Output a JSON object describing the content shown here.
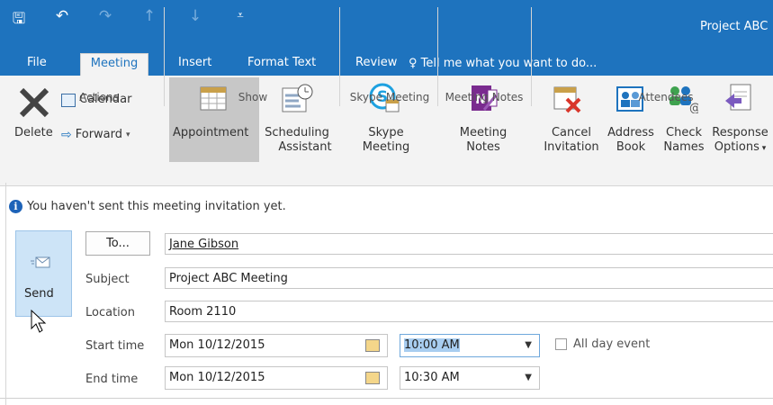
{
  "window": {
    "title": "Project ABC"
  },
  "tabs": [
    "File",
    "Meeting",
    "Insert",
    "Format Text",
    "Review"
  ],
  "tell_me": "Tell me what you want to do...",
  "ribbon": {
    "actions": {
      "delete": "Delete",
      "calendar": "Calendar",
      "forward": "Forward",
      "group": "Actions"
    },
    "show": {
      "appointment": "Appointment",
      "scheduling_1": "Scheduling",
      "scheduling_2": "Assistant",
      "group": "Show"
    },
    "skype": {
      "line1": "Skype",
      "line2": "Meeting",
      "group": "Skype Meeting"
    },
    "notes": {
      "line1": "Meeting",
      "line2": "Notes",
      "group": "Meeting Notes"
    },
    "attendees": {
      "cancel_1": "Cancel",
      "cancel_2": "Invitation",
      "address_1": "Address",
      "address_2": "Book",
      "check_1": "Check",
      "check_2": "Names",
      "response_1": "Response",
      "response_2": "Options",
      "group": "Attendees"
    }
  },
  "info_bar": "You haven't sent this meeting invitation yet.",
  "form": {
    "send": "Send",
    "to_button": "To...",
    "to_value": "Jane Gibson",
    "subject_label": "Subject",
    "subject_value": "Project ABC Meeting",
    "location_label": "Location",
    "location_value": "Room 2110",
    "start_label": "Start time",
    "start_date": "Mon 10/12/2015",
    "start_time": "10:00 AM",
    "all_day": "All day event",
    "end_label": "End time",
    "end_date": "Mon 10/12/2015",
    "end_time": "10:30 AM"
  },
  "colors": {
    "accent": "#1e73be",
    "selected": "#c7c7c7",
    "send_bg": "#cde4f7"
  }
}
